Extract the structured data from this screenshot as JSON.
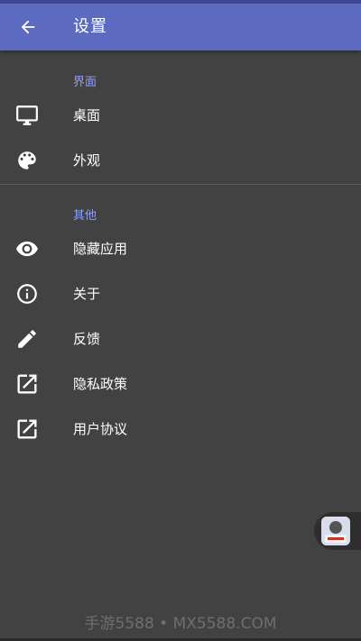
{
  "appbar": {
    "title": "设置",
    "back_icon": "arrow-back-icon"
  },
  "sections": [
    {
      "header": "界面",
      "items": [
        {
          "label": "桌面",
          "icon": "monitor-icon"
        },
        {
          "label": "外观",
          "icon": "palette-icon"
        }
      ]
    },
    {
      "header": "其他",
      "items": [
        {
          "label": "隐藏应用",
          "icon": "eye-icon"
        },
        {
          "label": "关于",
          "icon": "info-icon"
        },
        {
          "label": "反馈",
          "icon": "pencil-icon"
        },
        {
          "label": "隐私政策",
          "icon": "open-external-icon"
        },
        {
          "label": "用户协议",
          "icon": "open-external-icon"
        }
      ]
    }
  ],
  "watermark": "手游5588 • MX5588.COM",
  "colors": {
    "appbar": "#5c6bc0",
    "background": "#424242",
    "section_header": "#8c9eff",
    "text": "#ffffff"
  }
}
